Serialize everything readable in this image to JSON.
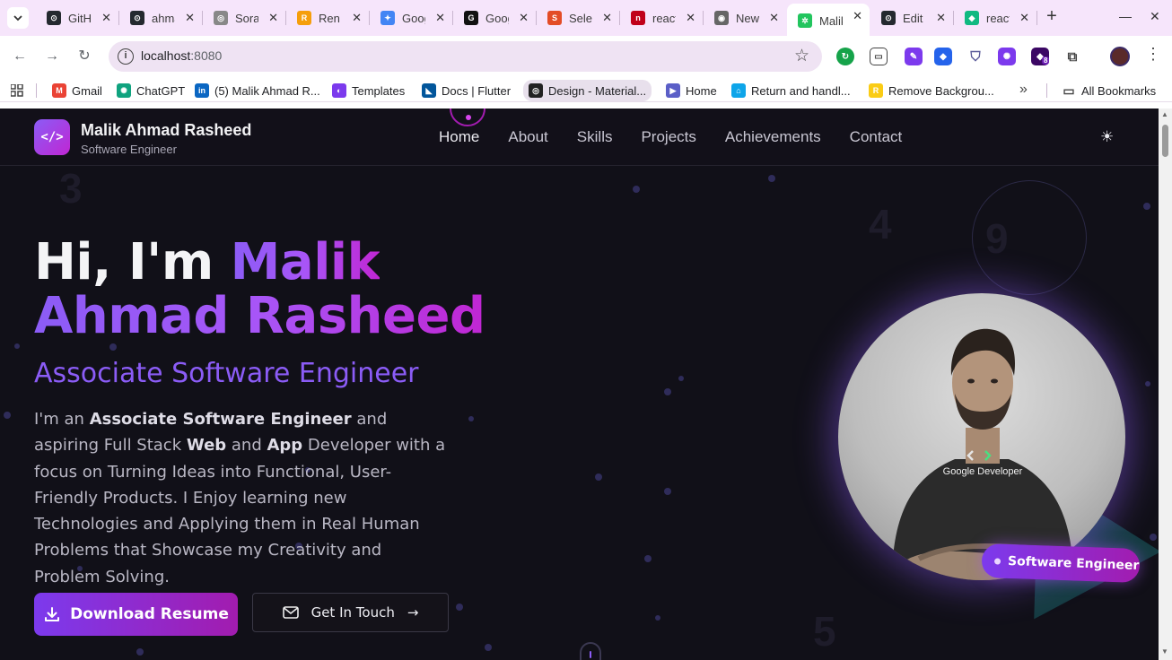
{
  "browser": {
    "tabs": [
      {
        "title": "GitHub",
        "color": "#24292f",
        "glyph": "⊙"
      },
      {
        "title": "ahmad",
        "color": "#24292f",
        "glyph": "⊙"
      },
      {
        "title": "Sora",
        "color": "#888888",
        "glyph": "◎"
      },
      {
        "title": "Ren",
        "color": "#f59e0b",
        "glyph": "R"
      },
      {
        "title": "Google",
        "color": "#4285f4",
        "glyph": "✦"
      },
      {
        "title": "Google",
        "color": "#111111",
        "glyph": "G"
      },
      {
        "title": "Select",
        "color": "#e34c26",
        "glyph": "S"
      },
      {
        "title": "react",
        "color": "#c0001a",
        "glyph": "n"
      },
      {
        "title": "New",
        "color": "#666666",
        "glyph": "◉"
      },
      {
        "title": "Malik",
        "color": "#22c55e",
        "glyph": "✲"
      },
      {
        "title": "Edit",
        "color": "#24292f",
        "glyph": "⊙"
      },
      {
        "title": "react",
        "color": "#10b981",
        "glyph": "◆"
      }
    ],
    "active_tab_index": 9,
    "address": {
      "host": "localhost",
      "port": ":8080"
    },
    "bookmarks": [
      {
        "label": "Gmail",
        "color": "#ea4335",
        "glyph": "M"
      },
      {
        "label": "ChatGPT",
        "color": "#10a37f",
        "glyph": "✺"
      },
      {
        "label": "(5) Malik Ahmad R...",
        "color": "#0a66c2",
        "glyph": "in"
      },
      {
        "label": "Templates",
        "color": "#7c3aed",
        "glyph": "◐"
      },
      {
        "label": "Docs | Flutter",
        "color": "#02569b",
        "glyph": "◣"
      },
      {
        "label": "Design - Material...",
        "color": "#222222",
        "glyph": "◎"
      },
      {
        "label": "Home",
        "color": "#5b5fc7",
        "glyph": "▶"
      },
      {
        "label": "Return and handl...",
        "color": "#0ea5e9",
        "glyph": "⌂"
      },
      {
        "label": "Remove Backgrou...",
        "color": "#facc15",
        "glyph": "R"
      }
    ],
    "all_bookmarks": "All Bookmarks"
  },
  "site": {
    "brand": {
      "name": "Malik Ahmad Rasheed",
      "role": "Software Engineer",
      "logo_glyph": "</>"
    },
    "nav": [
      "Home",
      "About",
      "Skills",
      "Projects",
      "Achievements",
      "Contact"
    ],
    "active_nav": "Home",
    "hero": {
      "greeting": "Hi, I'm ",
      "name_line1": "Malik",
      "name_line2": "Ahmad Rasheed",
      "subtitle": "Associate Software Engineer",
      "body_parts": [
        {
          "text": "I'm an ",
          "bold": false
        },
        {
          "text": "Associate Software Engineer",
          "bold": true
        },
        {
          "text": " and aspiring Full Stack ",
          "bold": false
        },
        {
          "text": "Web",
          "bold": true
        },
        {
          "text": " and ",
          "bold": false
        },
        {
          "text": "App",
          "bold": true
        },
        {
          "text": " Developer with a focus on Turning Ideas into Functional, User-Friendly Products. I Enjoy learning new Technologies and Applying them in Real Human Problems that Showcase my Creativity and Problem Solving.",
          "bold": false
        }
      ],
      "primary_button": "Download Resume",
      "secondary_button": "Get In Touch",
      "badge": "Software Engineer",
      "shirt_text": "Google Developer"
    },
    "background_numbers": [
      "3",
      "4",
      "9",
      "5"
    ],
    "accent": "#8b5cf6",
    "accent2": "#a21caf",
    "background": "#111018"
  }
}
